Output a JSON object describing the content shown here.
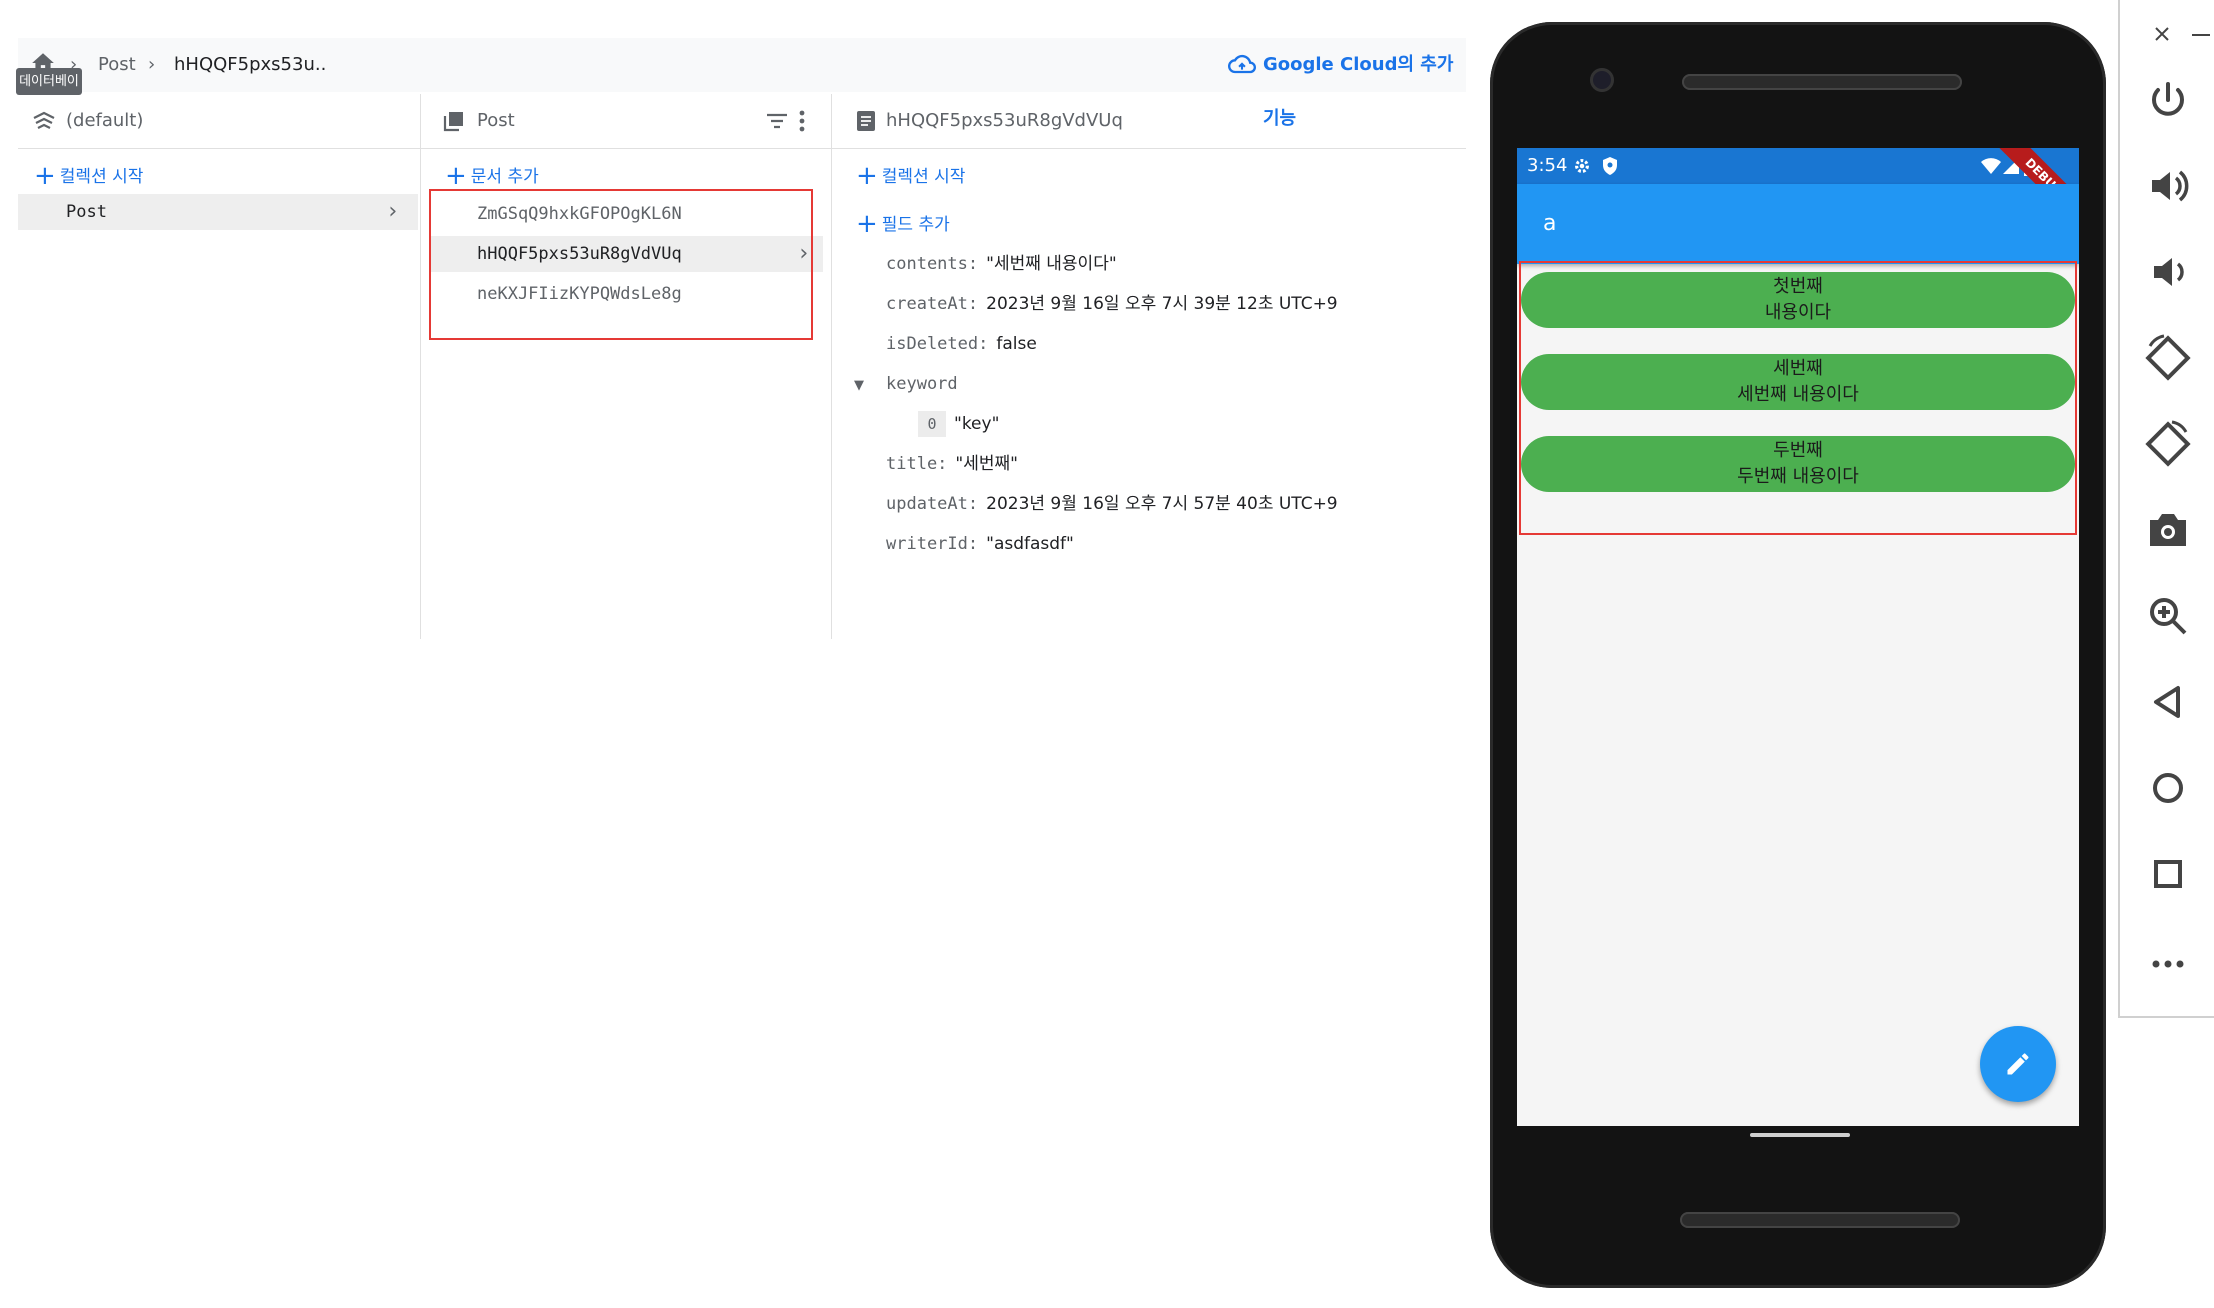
{
  "console": {
    "breadcrumb": {
      "post": "Post",
      "doc": "hHQQF5pxs53u.."
    },
    "tooltip": "데이터베이스",
    "gcloud_link": "Google Cloud의 추가 기능",
    "col1": {
      "header": "(default)",
      "action": "컬렉션 시작",
      "items": [
        {
          "label": "Post"
        }
      ]
    },
    "col2": {
      "header": "Post",
      "action": "문서 추가",
      "items": [
        {
          "label": "ZmGSqQ9hxkGFOPOgKL6N"
        },
        {
          "label": "hHQQF5pxs53uR8gVdVUq"
        },
        {
          "label": "neKXJFIizKYPQWdsLe8g"
        }
      ]
    },
    "col3": {
      "header": "hHQQF5pxs53uR8gVdVUq",
      "action_collection": "컬렉션 시작",
      "action_field": "필드 추가",
      "fields": {
        "contents": {
          "key": "contents:",
          "value": "\"세번째 내용이다\""
        },
        "createAt": {
          "key": "createAt:",
          "value": "2023년 9월 16일 오후 7시 39분 12초 UTC+9"
        },
        "isDeleted": {
          "key": "isDeleted:",
          "value": "false"
        },
        "keyword": {
          "key": "keyword",
          "index": "0",
          "value": "\"key\""
        },
        "title": {
          "key": "title:",
          "value": "\"세번째\""
        },
        "updateAt": {
          "key": "updateAt:",
          "value": "2023년 9월 16일 오후 7시 57분 40초 UTC+9"
        },
        "writerId": {
          "key": "writerId:",
          "value": "\"asdfasdf\""
        }
      }
    }
  },
  "phone": {
    "status_time": "3:54",
    "debug_banner": "DEBUG",
    "appbar_title": "a",
    "posts": [
      {
        "title": "첫번째",
        "content": "내용이다"
      },
      {
        "title": "세번째",
        "content": "세번째 내용이다"
      },
      {
        "title": "두번째",
        "content": "두번째 내용이다"
      }
    ],
    "fab_icon": "pencil-icon"
  },
  "emulator_toolbar": {
    "icons": [
      "close-icon",
      "minimize-icon",
      "power-icon",
      "volume-up-icon",
      "volume-down-icon",
      "rotate-left-icon",
      "rotate-right-icon",
      "camera-icon",
      "zoom-icon",
      "back-icon",
      "home-icon",
      "overview-icon",
      "more-icon"
    ]
  },
  "colors": {
    "accent": "#1a73e8",
    "appbar": "#2196f3",
    "post_bg": "#4caf50",
    "highlight": "#e53935"
  }
}
